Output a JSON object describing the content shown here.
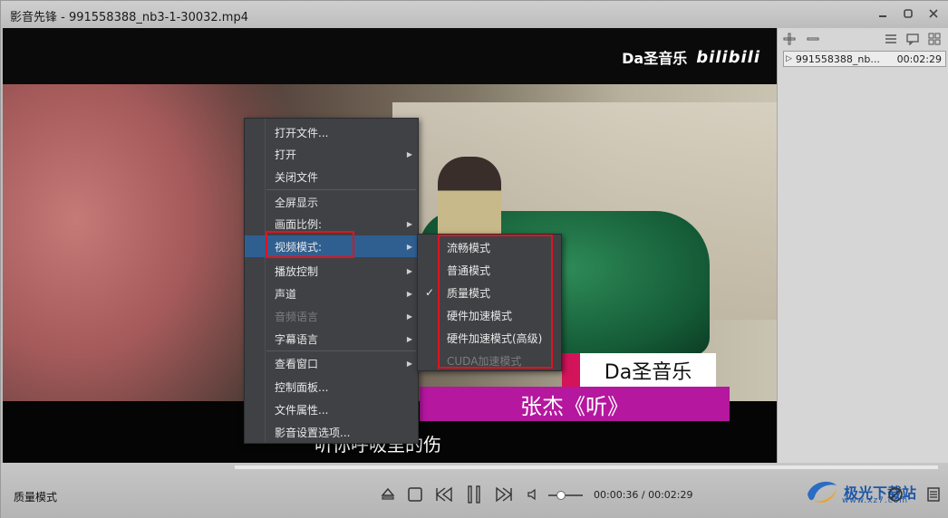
{
  "window": {
    "title": "影音先锋 - 991558388_nb3-1-30032.mp4"
  },
  "video": {
    "watermark_text": "Da圣音乐",
    "watermark_logo": "bilibili",
    "caption_singer": "Da圣音乐",
    "caption_song": "张杰《听》",
    "subtitle": "听你呼吸里的伤"
  },
  "playlist": {
    "items": [
      {
        "name": "991558388_nb...",
        "duration": "00:02:29"
      }
    ]
  },
  "controls": {
    "mode_label": "质量模式",
    "time": "00:00:36 / 00:02:29",
    "volume_percent": 40,
    "site_logo": "极光下载站",
    "site_url": "www.xz7.com"
  },
  "context_menu": {
    "items": [
      {
        "label": "打开文件...",
        "arrow": false,
        "disabled": false
      },
      {
        "label": "打开",
        "arrow": true,
        "disabled": false
      },
      {
        "label": "关闭文件",
        "arrow": false,
        "disabled": false
      },
      {
        "label": "全屏显示",
        "arrow": false,
        "disabled": false
      },
      {
        "label": "画面比例:",
        "arrow": true,
        "disabled": false
      },
      {
        "label": "视频模式:",
        "arrow": true,
        "disabled": false,
        "active": true
      },
      {
        "label": "播放控制",
        "arrow": true,
        "disabled": false
      },
      {
        "label": "声道",
        "arrow": true,
        "disabled": false
      },
      {
        "label": "音频语言",
        "arrow": true,
        "disabled": true
      },
      {
        "label": "字幕语言",
        "arrow": true,
        "disabled": false
      },
      {
        "label": "查看窗口",
        "arrow": true,
        "disabled": false
      },
      {
        "label": "控制面板...",
        "arrow": false,
        "disabled": false
      },
      {
        "label": "文件属性...",
        "arrow": false,
        "disabled": false
      },
      {
        "label": "影音设置选项...",
        "arrow": false,
        "disabled": false
      }
    ]
  },
  "video_mode_submenu": {
    "items": [
      {
        "label": "流畅模式",
        "checked": false,
        "disabled": false
      },
      {
        "label": "普通模式",
        "checked": false,
        "disabled": false
      },
      {
        "label": "质量模式",
        "checked": true,
        "disabled": false
      },
      {
        "label": "硬件加速模式",
        "checked": false,
        "disabled": false
      },
      {
        "label": "硬件加速模式(高级)",
        "checked": false,
        "disabled": false
      },
      {
        "label": "CUDA加速模式",
        "checked": false,
        "disabled": true
      }
    ]
  },
  "colors": {
    "highlight_border": "#e0141e",
    "menu_bg": "#3f4145",
    "caption_magenta": "#b5179e"
  }
}
